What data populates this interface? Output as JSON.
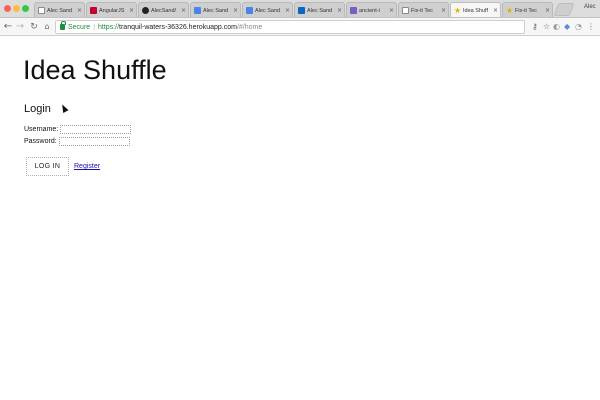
{
  "browser": {
    "tabs": [
      {
        "title": "Alec Sand",
        "favicon": "doc-icon",
        "close": "×",
        "active": false
      },
      {
        "title": "AngularJS",
        "favicon": "angular-icon",
        "close": "×",
        "active": false
      },
      {
        "title": "AlecSand/",
        "favicon": "github-icon",
        "close": "×",
        "active": false
      },
      {
        "title": "Alec Sand",
        "favicon": "blue-doc-icon",
        "close": "×",
        "active": false
      },
      {
        "title": "Alec Sand",
        "favicon": "blue-doc-icon",
        "close": "×",
        "active": false
      },
      {
        "title": "Alec Sand",
        "favicon": "linkedin-icon",
        "close": "×",
        "active": false
      },
      {
        "title": "ancient-i",
        "favicon": "purple-icon",
        "close": "×",
        "active": false
      },
      {
        "title": "Fix-it Tec",
        "favicon": "doc-icon",
        "close": "×",
        "active": false
      },
      {
        "title": "Idea Shuff",
        "favicon": "star-icon",
        "close": "×",
        "active": true
      },
      {
        "title": "Fix-it Tec",
        "favicon": "star-icon",
        "close": "×",
        "active": false
      }
    ],
    "profile_name": "Alec",
    "address_bar": {
      "secure_label": "Secure",
      "separator": "|",
      "scheme": "https://",
      "host": "tranquil-waters-36326.herokuapp.com",
      "path": "/#/home"
    },
    "icons": {
      "back": "←",
      "forward": "→",
      "reload": "↻",
      "home": "⌂",
      "key": "⚷",
      "star": "☆",
      "ext1": "◐",
      "ext2": "◆",
      "ext3": "◔",
      "menu": "⋮"
    }
  },
  "page": {
    "title": "Idea Shuffle",
    "login_heading": "Login",
    "username_label": "Username:",
    "username_value": "",
    "password_label": "Password:",
    "password_value": "",
    "login_button": "LOG IN",
    "register_link": "Register"
  }
}
